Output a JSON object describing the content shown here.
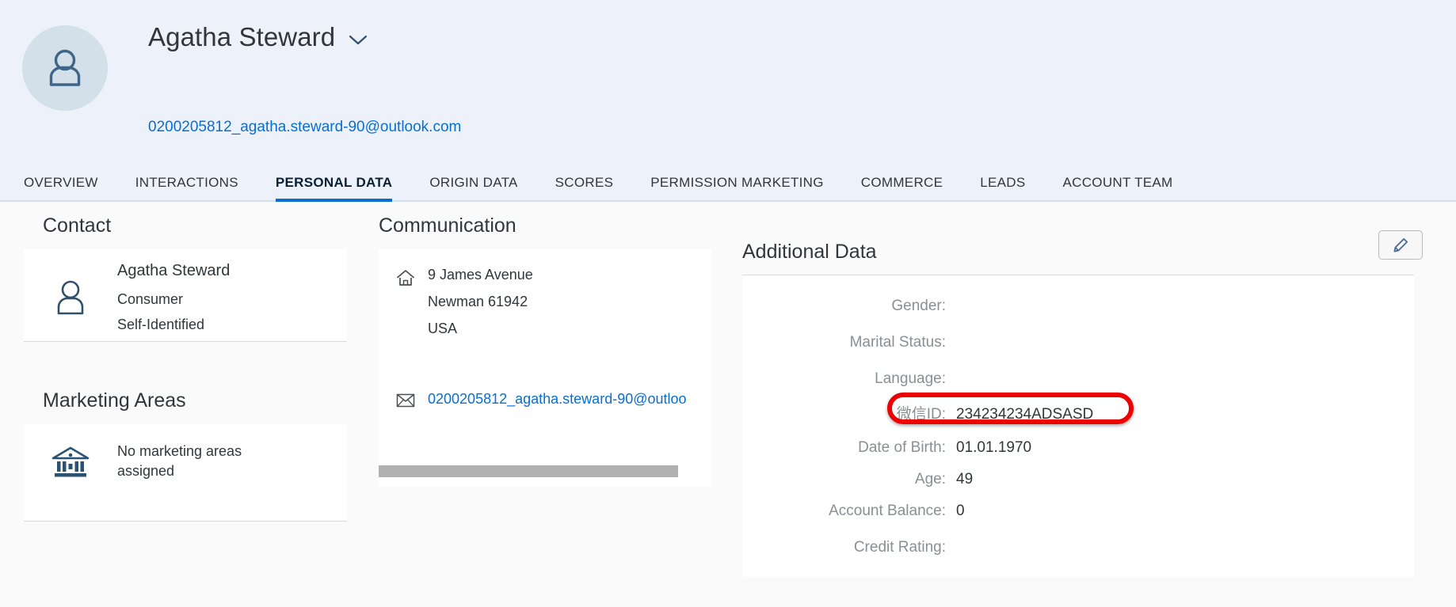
{
  "header": {
    "avatar_icon": "person-avatar-icon",
    "title": "Agatha Steward",
    "chevron_icon": "chevron-down-icon",
    "email": "0200205812_agatha.steward-90@outlook.com",
    "background_color": "#edf2fa",
    "avatar_bg_color": "#d3e0ea",
    "avatar_fg_color": "#3f6588",
    "link_color": "#0a6ed1"
  },
  "tabs": [
    {
      "label": "OVERVIEW",
      "active": false
    },
    {
      "label": "INTERACTIONS",
      "active": false
    },
    {
      "label": "PERSONAL DATA",
      "active": true
    },
    {
      "label": "ORIGIN DATA",
      "active": false
    },
    {
      "label": "SCORES",
      "active": false
    },
    {
      "label": "PERMISSION MARKETING",
      "active": false
    },
    {
      "label": "COMMERCE",
      "active": false
    },
    {
      "label": "LEADS",
      "active": false
    },
    {
      "label": "ACCOUNT TEAM",
      "active": false
    }
  ],
  "toolbar": {
    "edit_icon": "pencil-edit-icon",
    "edit_label": "Edit"
  },
  "contact": {
    "section_title": "Contact",
    "icon": "person-icon",
    "name": "Agatha Steward",
    "type": "Consumer",
    "origin": "Self-Identified"
  },
  "marketing_areas": {
    "section_title": "Marketing Areas",
    "icon": "bank-building-icon",
    "empty_text": "No marketing areas assigned"
  },
  "communication": {
    "section_title": "Communication",
    "address_icon": "home-icon",
    "address": [
      "9 James Avenue",
      "Newman 61942",
      "USA"
    ],
    "email_icon": "envelope-icon",
    "email": "0200205812_agatha.steward-90@outloo",
    "scrollbar": "horizontal-scrollbar"
  },
  "additional_data": {
    "section_title": "Additional Data",
    "fields": [
      {
        "label": "Gender:",
        "value": "",
        "highlighted": false
      },
      {
        "label": "Marital Status:",
        "value": "",
        "highlighted": false
      },
      {
        "label": "Language:",
        "value": "",
        "highlighted": false
      },
      {
        "label": "微信ID:",
        "value": "234234234ADSASD",
        "highlighted": true
      },
      {
        "label": "Date of Birth:",
        "value": "01.01.1970",
        "highlighted": false
      },
      {
        "label": "Age:",
        "value": "49",
        "highlighted": false
      },
      {
        "label": "Account Balance:",
        "value": "0",
        "highlighted": false
      },
      {
        "label": "Credit Rating:",
        "value": "",
        "highlighted": false
      }
    ],
    "annotation_color": "#ee0000"
  }
}
